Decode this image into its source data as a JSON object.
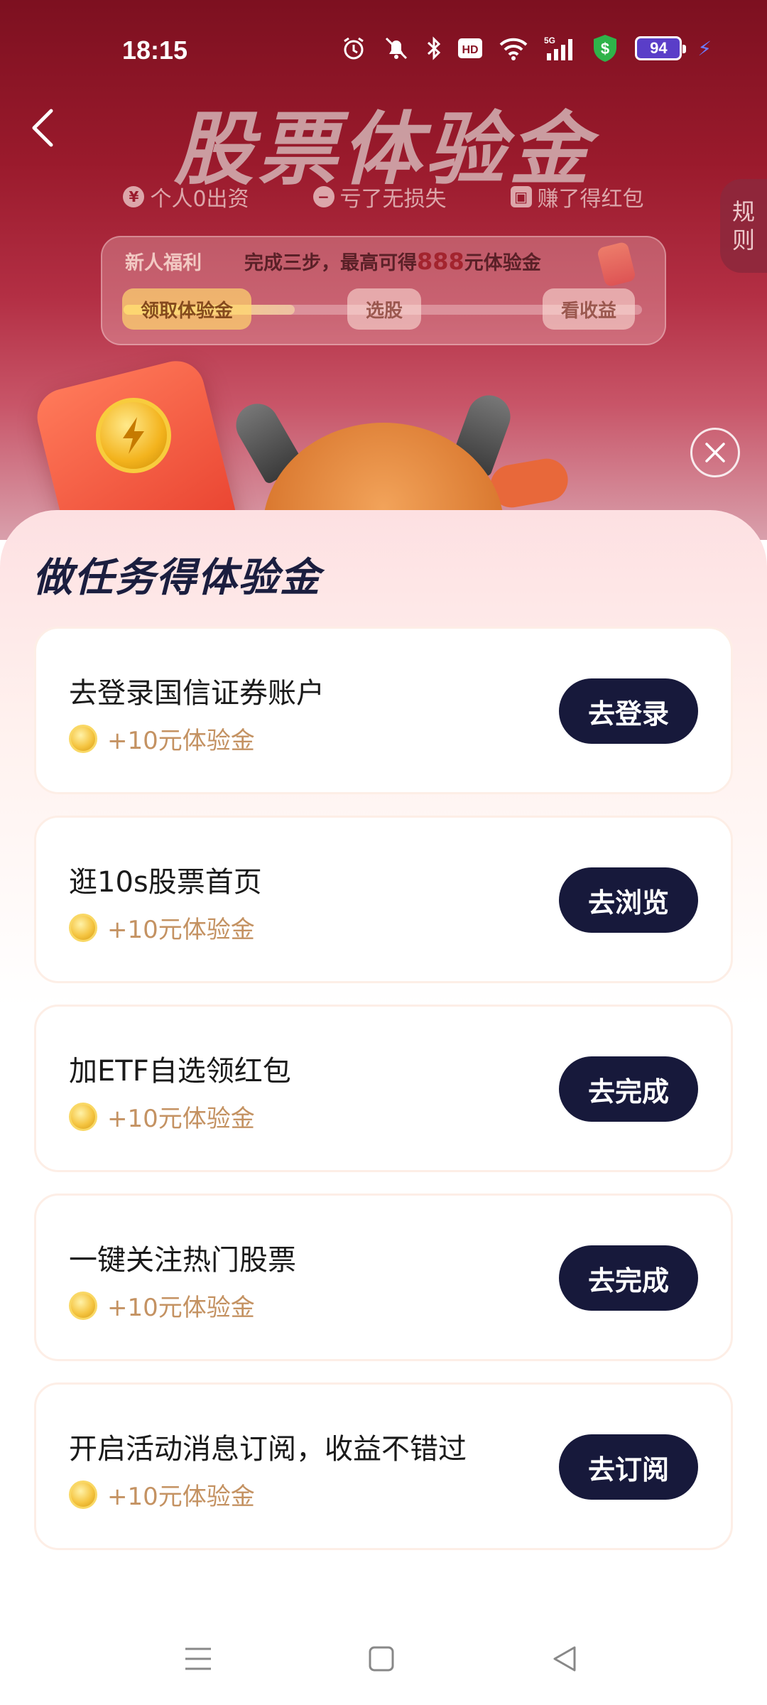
{
  "status_bar": {
    "time": "18:15",
    "network": "5G",
    "battery": "94"
  },
  "hero": {
    "title": "股票体验金",
    "tags": [
      "个人0出资",
      "亏了无损失",
      "赚了得红包"
    ],
    "tag_icons": [
      "yuan-icon",
      "minus-icon",
      "gift-icon"
    ],
    "rules_label_1": "规",
    "rules_label_2": "则",
    "newbie": {
      "label": "新人福利",
      "desc_prefix": "完成三步，最高可得",
      "desc_amount": "888",
      "desc_suffix": "元体验金",
      "steps": [
        "领取体验金",
        "选股",
        "看收益"
      ],
      "progress": 0.33
    }
  },
  "sheet": {
    "title": "做任务得体验金",
    "tasks": [
      {
        "title": "去登录国信证券账户",
        "reward": "+10元体验金",
        "button": "去登录"
      },
      {
        "title": "逛10s股票首页",
        "reward": "+10元体验金",
        "button": "去浏览"
      },
      {
        "title": "加ETF自选领红包",
        "reward": "+10元体验金",
        "button": "去完成"
      },
      {
        "title": "一键关注热门股票",
        "reward": "+10元体验金",
        "button": "去完成"
      },
      {
        "title": "开启活动消息订阅，收益不错过",
        "reward": "+10元体验金",
        "button": "去订阅"
      }
    ]
  },
  "colors": {
    "hero_bg": "#9a1a2c",
    "button_bg": "#17193b",
    "reward_text": "#c49262",
    "title_text": "#1b1e3f"
  }
}
